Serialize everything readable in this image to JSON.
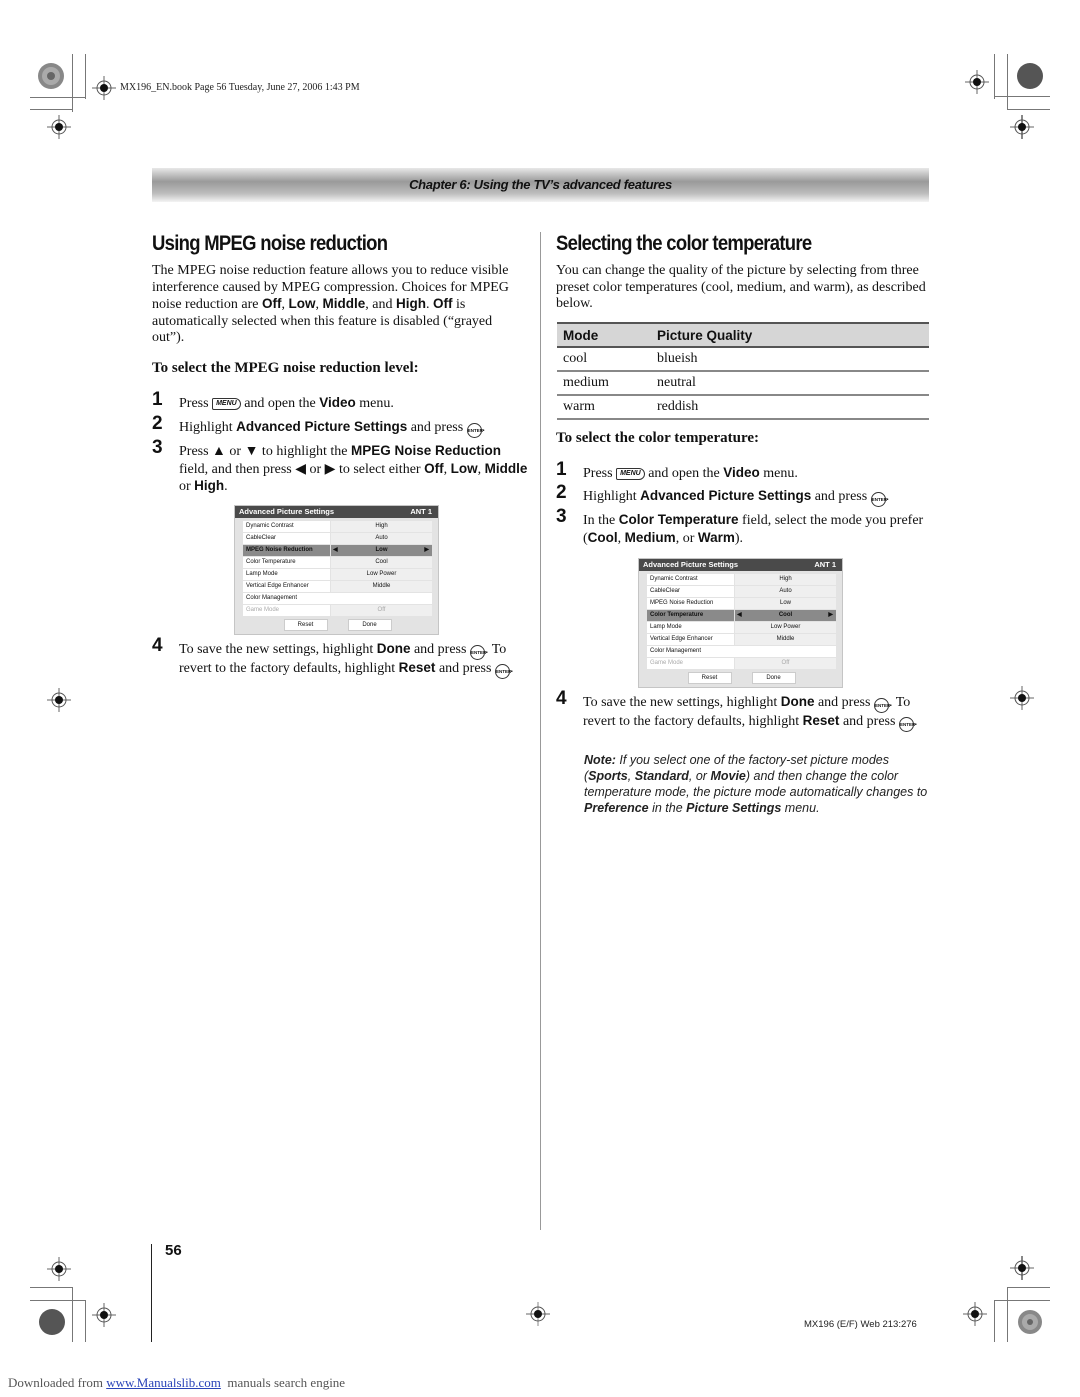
{
  "header": {
    "book_info": "MX196_EN.book  Page 56  Tuesday, June 27, 2006  1:43 PM",
    "chapter_title": "Chapter 6: Using the TV’s advanced features"
  },
  "left": {
    "title": "Using MPEG noise reduction",
    "intro": {
      "t1": "The MPEG noise reduction feature allows you to reduce visible interference caused by MPEG compression. Choices for MPEG noise reduction are ",
      "b1": "Off",
      "t2": ", ",
      "b2": "Low",
      "t3": ", ",
      "b3": "Middle",
      "t4": ", and ",
      "b4": "High",
      "t5": ". ",
      "b5": "Off",
      "t6": " is automatically selected when this feature is disabled (“grayed out”)."
    },
    "subheading": "To select the MPEG noise reduction level:",
    "steps": [
      {
        "num": "1",
        "t1": "Press ",
        "key": "MENU",
        "t2": " and open the ",
        "b1": "Video",
        "t3": " menu."
      },
      {
        "num": "2",
        "t1": "Highlight ",
        "b1": "Advanced Picture Settings",
        "t2": " and press ",
        "key": "ENTER",
        "t3": "."
      },
      {
        "num": "3",
        "t1": "Press ▲ or ▼ to highlight the ",
        "b1": "MPEG Noise Reduction",
        "t2": " field, and then press ◀ or ▶ to select either ",
        "b2": "Off",
        "t3": ", ",
        "b3": "Low",
        "t4": ", ",
        "b4": "Middle",
        "t5": " or ",
        "b5": "High",
        "t6": "."
      },
      {
        "num": "4",
        "t1": "To save the new settings, highlight ",
        "b1": "Done",
        "t2": " and press ",
        "key": "ENTER",
        "t3": ". To revert to the factory defaults, highlight ",
        "b2": "Reset",
        "t4": " and press ",
        "t5": "."
      }
    ],
    "osd": {
      "title": "Advanced Picture Settings",
      "input": "ANT 1",
      "rows": [
        {
          "label": "Dynamic Contrast",
          "value": "High"
        },
        {
          "label": "CableClear",
          "value": "Auto"
        },
        {
          "label": "MPEG Noise Reduction",
          "value": "Low",
          "selected": true
        },
        {
          "label": "Color Temperature",
          "value": "Cool"
        },
        {
          "label": "Lamp Mode",
          "value": "Low Power"
        },
        {
          "label": "Vertical Edge Enhancer",
          "value": "Middle"
        },
        {
          "label": "Color Management",
          "value": ""
        },
        {
          "label": "Game Mode",
          "value": "Off",
          "disabled": true
        }
      ],
      "reset": "Reset",
      "done": "Done",
      "arrow_left": "◀",
      "arrow_right": "▶"
    }
  },
  "right": {
    "title": "Selecting the color temperature",
    "intro": "You can change the quality of the picture by selecting from three preset color temperatures (cool, medium, and warm), as described below.",
    "table": {
      "headers": [
        "Mode",
        "Picture Quality"
      ],
      "rows": [
        [
          "cool",
          "blueish"
        ],
        [
          "medium",
          "neutral"
        ],
        [
          "warm",
          "reddish"
        ]
      ]
    },
    "subheading": "To select the color temperature:",
    "steps": [
      {
        "num": "1",
        "t1": "Press ",
        "key": "MENU",
        "t2": " and open the ",
        "b1": "Video",
        "t3": " menu."
      },
      {
        "num": "2",
        "t1": "Highlight ",
        "b1": "Advanced Picture Settings",
        "t2": " and press ",
        "key": "ENTER",
        "t3": "."
      },
      {
        "num": "3",
        "t1": "In the ",
        "b1": "Color Temperature",
        "t2": " field, select the mode you prefer (",
        "b2": "Cool",
        "t3": ", ",
        "b3": "Medium",
        "t4": ", or ",
        "b4": "Warm",
        "t5": ")."
      },
      {
        "num": "4",
        "t1": "To save the new settings, highlight ",
        "b1": "Done",
        "t2": " and press ",
        "key": "ENTER",
        "t3": ". To revert to the factory defaults, highlight ",
        "b2": "Reset",
        "t4": " and press ",
        "t5": "."
      }
    ],
    "osd": {
      "title": "Advanced Picture Settings",
      "input": "ANT 1",
      "rows": [
        {
          "label": "Dynamic Contrast",
          "value": "High"
        },
        {
          "label": "CableClear",
          "value": "Auto"
        },
        {
          "label": "MPEG Noise Reduction",
          "value": "Low"
        },
        {
          "label": "Color Temperature",
          "value": "Cool",
          "selected": true
        },
        {
          "label": "Lamp Mode",
          "value": "Low Power"
        },
        {
          "label": "Vertical Edge Enhancer",
          "value": "Middle"
        },
        {
          "label": "Color Management",
          "value": ""
        },
        {
          "label": "Game Mode",
          "value": "Off",
          "disabled": true
        }
      ],
      "reset": "Reset",
      "done": "Done"
    },
    "note": {
      "label": "Note:",
      "t1": " If you select one of the factory-set picture modes (",
      "b1": "Sports",
      "t2": ", ",
      "b2": "Standard",
      "t3": ", or ",
      "b3": "Movie",
      "t4": ") and then change the color temperature mode, the picture mode automatically changes to ",
      "b4": "Preference",
      "t5": " in the ",
      "b5": "Picture Settings",
      "t6": " menu."
    }
  },
  "footer": {
    "page_number": "56",
    "print_code": "MX196 (E/F) Web 213:276",
    "download_prefix": "Downloaded from ",
    "download_link": "www.Manualslib.com",
    "download_suffix": "  manuals search engine"
  }
}
